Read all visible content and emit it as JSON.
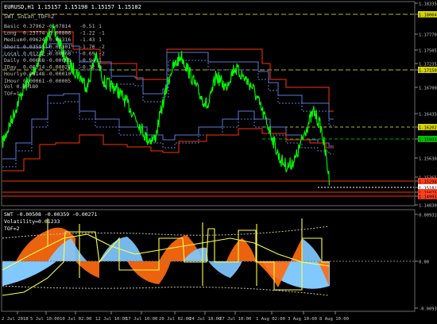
{
  "symbol_header": "EURUSD,H1  1.15157 1.15198 1.15157 1.15182",
  "indicator_title": "SWT_SnLan_TOF=2",
  "table": [
    {
      "label": "Basic",
      "v1": "0.37962",
      "v2": "-0.07814",
      "v3": "-0.51",
      "v4": "1"
    },
    {
      "label": "Long",
      "v1": "0.23774",
      "v2": "-0.00806",
      "v3": "-1.22",
      "v4": "-1"
    },
    {
      "label": "Medium",
      "v1": "0.09624",
      "v2": "-0.00316",
      "v3": "-1.43",
      "v4": "1"
    },
    {
      "label": "Short",
      "v1": "0.03595",
      "v2": "-0.00301",
      "v3": "-1.70",
      "v4": "-2"
    },
    {
      "label": "Local",
      "v1": "0.01232",
      "v2": "-0.00068",
      "v3": "-0.69",
      "v4": "-2"
    },
    {
      "label": "Daily",
      "v1": "0.00668",
      "v2": "-0.00068",
      "v3": "-0.94",
      "v4": "1"
    },
    {
      "label": "IDay",
      "v1": "0.00314",
      "v2": "-0.00028",
      "v3": "-0.32",
      "v4": "0"
    },
    {
      "label": "Hourly",
      "v1": "0.00148",
      "v2": "-0.00010",
      "v3": "",
      "v4": ""
    },
    {
      "label": "IHour",
      "v1": "0.00061",
      "v2": "-0.00005",
      "v3": "",
      "v4": ""
    }
  ],
  "vol_line": "Vol 0.00180",
  "tof_line_main": "TOF=1",
  "price_axis": [
    {
      "label": "1.18335",
      "highlight": ""
    },
    {
      "label": "1.18064",
      "highlight": "#d6d600"
    },
    {
      "label": "1.17770",
      "highlight": ""
    },
    {
      "label": "1.17505",
      "highlight": ""
    },
    {
      "label": "1.17235",
      "highlight": ""
    },
    {
      "label": "1.17150",
      "highlight": "#d6d600"
    },
    {
      "label": "1.16700",
      "highlight": ""
    },
    {
      "label": "1.16435",
      "highlight": ""
    },
    {
      "label": "1.16202",
      "highlight": "#d6d600"
    },
    {
      "label": "1.15933",
      "highlight": "#00c000"
    },
    {
      "label": "1.15630",
      "highlight": ""
    },
    {
      "label": "1.15365",
      "highlight": ""
    },
    {
      "label": "1.15298",
      "highlight": "#ff4020"
    },
    {
      "label": "1.15182",
      "highlight": "#ffffff"
    },
    {
      "label": "1.15075",
      "highlight": "#ff4020"
    },
    {
      "label": "1.14993",
      "highlight": "#ff4020"
    },
    {
      "label": "1.14830",
      "highlight": ""
    }
  ],
  "sub_header": "SWT  -0.00508 -0.00359 -0.00271",
  "sub_volatility": "Volatility=0.01233",
  "sub_tof": "TOF=2",
  "sub_axis": [
    "0.00931",
    "0.00",
    "-0.00931"
  ],
  "time_axis": [
    "2 Jul 2018",
    "5 Jul 10:00",
    "10 Jul 02:00",
    "12 Jul 10:00",
    "17 Jul 10:00",
    "20 Jul 02:00",
    "24 Jul 18:00",
    "27 Jul 10:00",
    "1 Aug 02:00",
    "3 Aug 10:00",
    "8 Aug 10:00"
  ],
  "colors": {
    "price": "#00ff00",
    "red": "#ff3300",
    "blue": "#5a78d8",
    "yellow": "#ffff40",
    "orange": "#ff6a10",
    "sky": "#80c8ff"
  }
}
